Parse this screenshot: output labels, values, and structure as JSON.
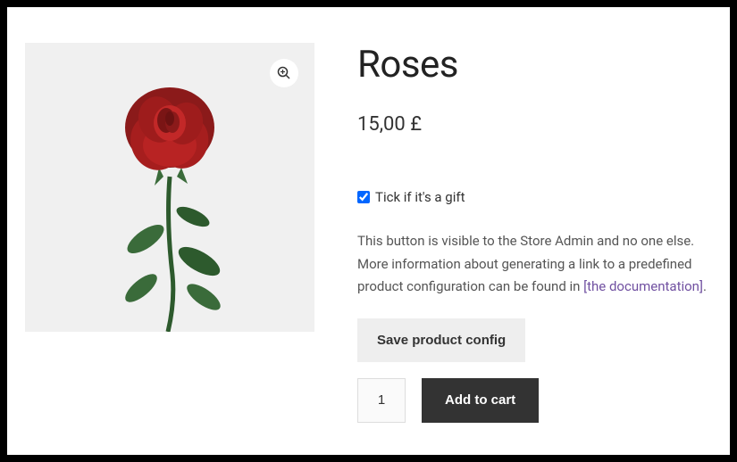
{
  "product": {
    "title": "Roses",
    "price": "15,00 £",
    "image_alt": "Red rose"
  },
  "gift": {
    "label": "Tick if it's a gift",
    "checked": true
  },
  "admin_note": {
    "text_before": "This button is visible to the Store Admin and no one else. More information about generating a link to a predefined product configuration can be found in ",
    "link_text": "[the documentation]",
    "text_after": "."
  },
  "buttons": {
    "save_config": "Save product config",
    "add_to_cart": "Add to cart"
  },
  "quantity": {
    "value": "1"
  }
}
